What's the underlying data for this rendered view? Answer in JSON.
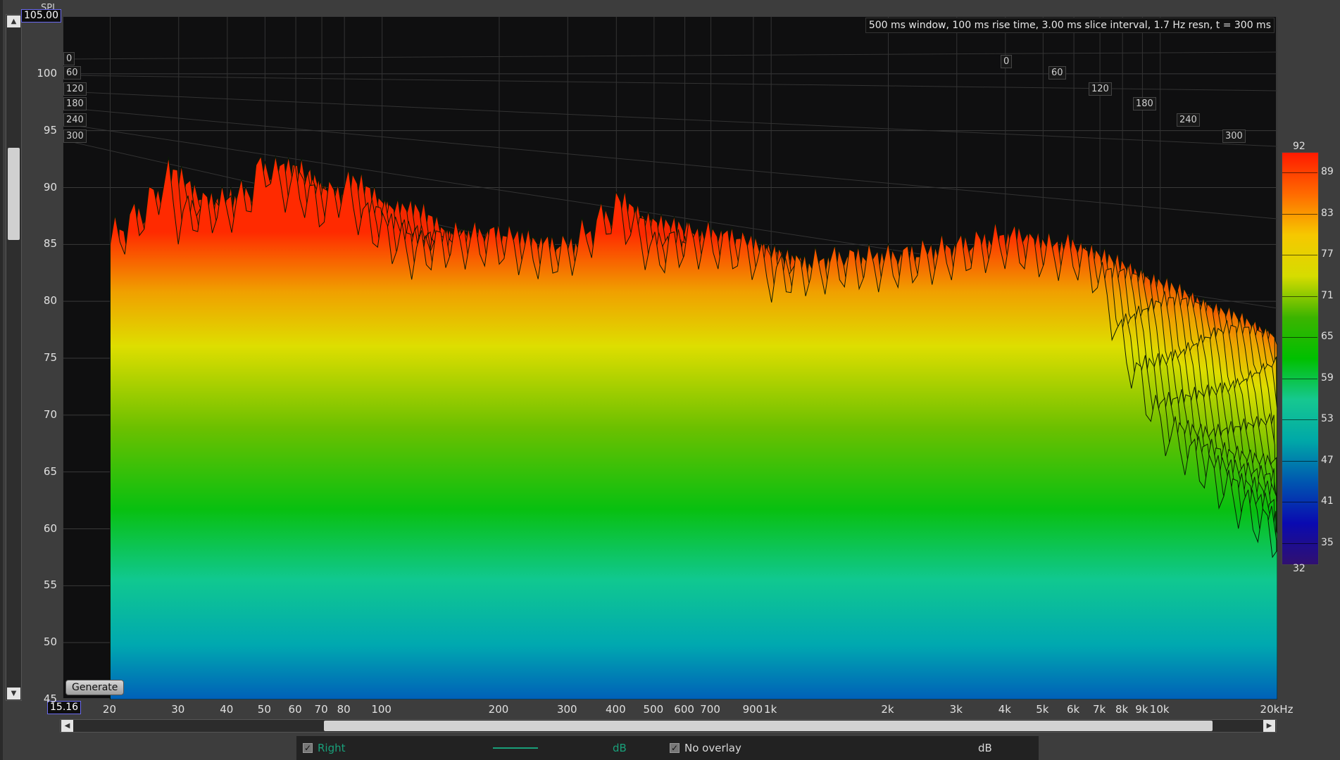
{
  "y_axis": {
    "label": "SPL",
    "top_value": "105.00",
    "bottom_value": "15.16",
    "ticks": [
      "100",
      "95",
      "90",
      "85",
      "80",
      "75",
      "70",
      "65",
      "60",
      "55",
      "50",
      "45"
    ]
  },
  "x_axis": {
    "ticks": [
      "20",
      "30",
      "40",
      "50",
      "60",
      "70",
      "80",
      "100",
      "200",
      "300",
      "400",
      "500",
      "600",
      "700",
      "900",
      "1k",
      "2k",
      "3k",
      "4k",
      "5k",
      "6k",
      "7k",
      "8k",
      "9k",
      "10k",
      "20kHz"
    ]
  },
  "info": "500 ms window, 100 ms rise time, 3.00 ms slice interval, 1.7 Hz resn, t = 300 ms",
  "time_labels": [
    "0",
    "60",
    "120",
    "180",
    "240",
    "300"
  ],
  "time_labels_right": [
    "0",
    "60",
    "120",
    "180",
    "240",
    "300"
  ],
  "generate_label": "Generate",
  "colorbar": {
    "top": "92",
    "bottom": "32",
    "ticks": [
      "89",
      "83",
      "77",
      "71",
      "65",
      "59",
      "53",
      "47",
      "41",
      "35"
    ],
    "colors": [
      "#ff1a00",
      "#ff6a00",
      "#f6c800",
      "#d6dc00",
      "#3cb400",
      "#00c000",
      "#16c890",
      "#00a8a8",
      "#0056b0",
      "#0a0ab0",
      "#301070"
    ]
  },
  "legend": {
    "channel": "Right",
    "channel_unit": "dB",
    "channel_color": "#19a07a",
    "overlay": "No overlay",
    "overlay_unit": "dB"
  },
  "chart_data": {
    "type": "area",
    "xscale": "log",
    "xlim": [
      15.16,
      20000
    ],
    "ylim": [
      45,
      105
    ],
    "ylabel": "SPL",
    "time_range_ms": [
      0,
      300
    ],
    "front_slice": {
      "x": [
        20,
        25,
        28,
        30,
        35,
        40,
        45,
        50,
        55,
        60,
        70,
        80,
        90,
        100,
        120,
        150,
        200,
        250,
        300,
        400,
        500,
        600,
        700,
        900,
        1000,
        1500,
        2000,
        3000,
        4000,
        5000,
        6000,
        7000,
        8000,
        10000,
        15000,
        20000
      ],
      "y": [
        85,
        88,
        91,
        87,
        88,
        88,
        89,
        92,
        90,
        90,
        88,
        90,
        87,
        86,
        84,
        85,
        85,
        84,
        84,
        88,
        84,
        85,
        85,
        84,
        82,
        83,
        83,
        84,
        85,
        84,
        84,
        82,
        76,
        69,
        63,
        59
      ]
    }
  }
}
